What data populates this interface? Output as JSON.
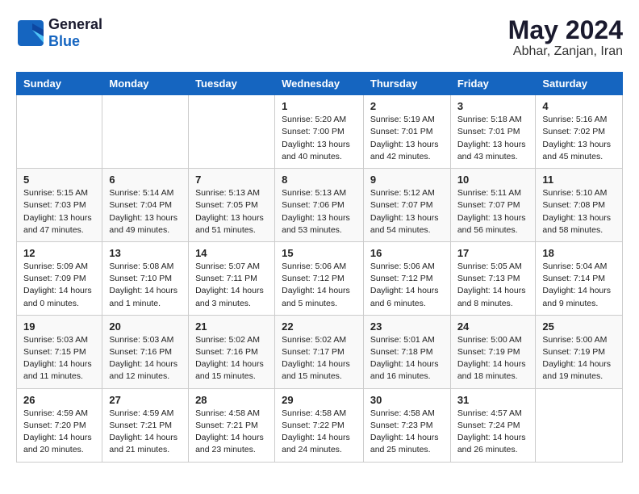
{
  "logo": {
    "line1": "General",
    "line2": "Blue"
  },
  "title": "May 2024",
  "subtitle": "Abhar, Zanjan, Iran",
  "weekdays": [
    "Sunday",
    "Monday",
    "Tuesday",
    "Wednesday",
    "Thursday",
    "Friday",
    "Saturday"
  ],
  "weeks": [
    [
      {
        "day": "",
        "sunrise": "",
        "sunset": "",
        "daylight": ""
      },
      {
        "day": "",
        "sunrise": "",
        "sunset": "",
        "daylight": ""
      },
      {
        "day": "",
        "sunrise": "",
        "sunset": "",
        "daylight": ""
      },
      {
        "day": "1",
        "sunrise": "Sunrise: 5:20 AM",
        "sunset": "Sunset: 7:00 PM",
        "daylight": "Daylight: 13 hours and 40 minutes."
      },
      {
        "day": "2",
        "sunrise": "Sunrise: 5:19 AM",
        "sunset": "Sunset: 7:01 PM",
        "daylight": "Daylight: 13 hours and 42 minutes."
      },
      {
        "day": "3",
        "sunrise": "Sunrise: 5:18 AM",
        "sunset": "Sunset: 7:01 PM",
        "daylight": "Daylight: 13 hours and 43 minutes."
      },
      {
        "day": "4",
        "sunrise": "Sunrise: 5:16 AM",
        "sunset": "Sunset: 7:02 PM",
        "daylight": "Daylight: 13 hours and 45 minutes."
      }
    ],
    [
      {
        "day": "5",
        "sunrise": "Sunrise: 5:15 AM",
        "sunset": "Sunset: 7:03 PM",
        "daylight": "Daylight: 13 hours and 47 minutes."
      },
      {
        "day": "6",
        "sunrise": "Sunrise: 5:14 AM",
        "sunset": "Sunset: 7:04 PM",
        "daylight": "Daylight: 13 hours and 49 minutes."
      },
      {
        "day": "7",
        "sunrise": "Sunrise: 5:13 AM",
        "sunset": "Sunset: 7:05 PM",
        "daylight": "Daylight: 13 hours and 51 minutes."
      },
      {
        "day": "8",
        "sunrise": "Sunrise: 5:13 AM",
        "sunset": "Sunset: 7:06 PM",
        "daylight": "Daylight: 13 hours and 53 minutes."
      },
      {
        "day": "9",
        "sunrise": "Sunrise: 5:12 AM",
        "sunset": "Sunset: 7:07 PM",
        "daylight": "Daylight: 13 hours and 54 minutes."
      },
      {
        "day": "10",
        "sunrise": "Sunrise: 5:11 AM",
        "sunset": "Sunset: 7:07 PM",
        "daylight": "Daylight: 13 hours and 56 minutes."
      },
      {
        "day": "11",
        "sunrise": "Sunrise: 5:10 AM",
        "sunset": "Sunset: 7:08 PM",
        "daylight": "Daylight: 13 hours and 58 minutes."
      }
    ],
    [
      {
        "day": "12",
        "sunrise": "Sunrise: 5:09 AM",
        "sunset": "Sunset: 7:09 PM",
        "daylight": "Daylight: 14 hours and 0 minutes."
      },
      {
        "day": "13",
        "sunrise": "Sunrise: 5:08 AM",
        "sunset": "Sunset: 7:10 PM",
        "daylight": "Daylight: 14 hours and 1 minute."
      },
      {
        "day": "14",
        "sunrise": "Sunrise: 5:07 AM",
        "sunset": "Sunset: 7:11 PM",
        "daylight": "Daylight: 14 hours and 3 minutes."
      },
      {
        "day": "15",
        "sunrise": "Sunrise: 5:06 AM",
        "sunset": "Sunset: 7:12 PM",
        "daylight": "Daylight: 14 hours and 5 minutes."
      },
      {
        "day": "16",
        "sunrise": "Sunrise: 5:06 AM",
        "sunset": "Sunset: 7:12 PM",
        "daylight": "Daylight: 14 hours and 6 minutes."
      },
      {
        "day": "17",
        "sunrise": "Sunrise: 5:05 AM",
        "sunset": "Sunset: 7:13 PM",
        "daylight": "Daylight: 14 hours and 8 minutes."
      },
      {
        "day": "18",
        "sunrise": "Sunrise: 5:04 AM",
        "sunset": "Sunset: 7:14 PM",
        "daylight": "Daylight: 14 hours and 9 minutes."
      }
    ],
    [
      {
        "day": "19",
        "sunrise": "Sunrise: 5:03 AM",
        "sunset": "Sunset: 7:15 PM",
        "daylight": "Daylight: 14 hours and 11 minutes."
      },
      {
        "day": "20",
        "sunrise": "Sunrise: 5:03 AM",
        "sunset": "Sunset: 7:16 PM",
        "daylight": "Daylight: 14 hours and 12 minutes."
      },
      {
        "day": "21",
        "sunrise": "Sunrise: 5:02 AM",
        "sunset": "Sunset: 7:16 PM",
        "daylight": "Daylight: 14 hours and 15 minutes."
      },
      {
        "day": "22",
        "sunrise": "Sunrise: 5:02 AM",
        "sunset": "Sunset: 7:17 PM",
        "daylight": "Daylight: 14 hours and 15 minutes."
      },
      {
        "day": "23",
        "sunrise": "Sunrise: 5:01 AM",
        "sunset": "Sunset: 7:18 PM",
        "daylight": "Daylight: 14 hours and 16 minutes."
      },
      {
        "day": "24",
        "sunrise": "Sunrise: 5:00 AM",
        "sunset": "Sunset: 7:19 PM",
        "daylight": "Daylight: 14 hours and 18 minutes."
      },
      {
        "day": "25",
        "sunrise": "Sunrise: 5:00 AM",
        "sunset": "Sunset: 7:19 PM",
        "daylight": "Daylight: 14 hours and 19 minutes."
      }
    ],
    [
      {
        "day": "26",
        "sunrise": "Sunrise: 4:59 AM",
        "sunset": "Sunset: 7:20 PM",
        "daylight": "Daylight: 14 hours and 20 minutes."
      },
      {
        "day": "27",
        "sunrise": "Sunrise: 4:59 AM",
        "sunset": "Sunset: 7:21 PM",
        "daylight": "Daylight: 14 hours and 21 minutes."
      },
      {
        "day": "28",
        "sunrise": "Sunrise: 4:58 AM",
        "sunset": "Sunset: 7:21 PM",
        "daylight": "Daylight: 14 hours and 23 minutes."
      },
      {
        "day": "29",
        "sunrise": "Sunrise: 4:58 AM",
        "sunset": "Sunset: 7:22 PM",
        "daylight": "Daylight: 14 hours and 24 minutes."
      },
      {
        "day": "30",
        "sunrise": "Sunrise: 4:58 AM",
        "sunset": "Sunset: 7:23 PM",
        "daylight": "Daylight: 14 hours and 25 minutes."
      },
      {
        "day": "31",
        "sunrise": "Sunrise: 4:57 AM",
        "sunset": "Sunset: 7:24 PM",
        "daylight": "Daylight: 14 hours and 26 minutes."
      },
      {
        "day": "",
        "sunrise": "",
        "sunset": "",
        "daylight": ""
      }
    ]
  ]
}
